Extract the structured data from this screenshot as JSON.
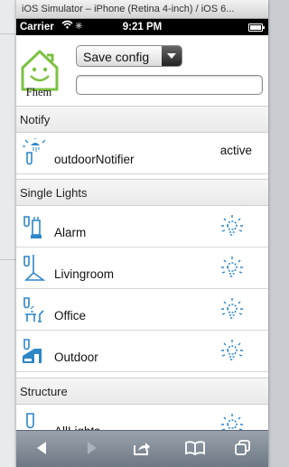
{
  "window": {
    "title": "iOS Simulator – iPhone (Retina 4-inch) / iOS 6..."
  },
  "status_bar": {
    "carrier": "Carrier",
    "time": "9:21 PM"
  },
  "header": {
    "logo_text": "Fhem",
    "save_select_value": "Save config",
    "command_input_value": ""
  },
  "sections": [
    {
      "title": "Notify",
      "items": [
        {
          "label": "outdoorNotifier",
          "state": "active",
          "icon": "notify-icon"
        }
      ]
    },
    {
      "title": "Single Lights",
      "items": [
        {
          "label": "Alarm",
          "icon": "alarm-light-icon",
          "state_icon": "light-bulb-icon"
        },
        {
          "label": "Livingroom",
          "icon": "ceiling-lamp-icon",
          "state_icon": "light-bulb-icon"
        },
        {
          "label": "Office",
          "icon": "desk-lamp-icon",
          "state_icon": "light-bulb-icon"
        },
        {
          "label": "Outdoor",
          "icon": "outdoor-house-icon",
          "state_icon": "light-bulb-icon"
        }
      ]
    },
    {
      "title": "Structure",
      "items": [
        {
          "label": "AllLights",
          "icon": "all-lights-icon",
          "state_icon": "light-bulb-icon"
        }
      ]
    }
  ],
  "toolbar": {
    "icons": [
      "back-icon",
      "forward-icon",
      "share-icon",
      "bookmarks-icon",
      "tabs-icon"
    ]
  },
  "colors": {
    "icon_blue": "#2d86c8",
    "toolbar_top": "#9aa3ad",
    "toolbar_bottom": "#6c7784"
  }
}
